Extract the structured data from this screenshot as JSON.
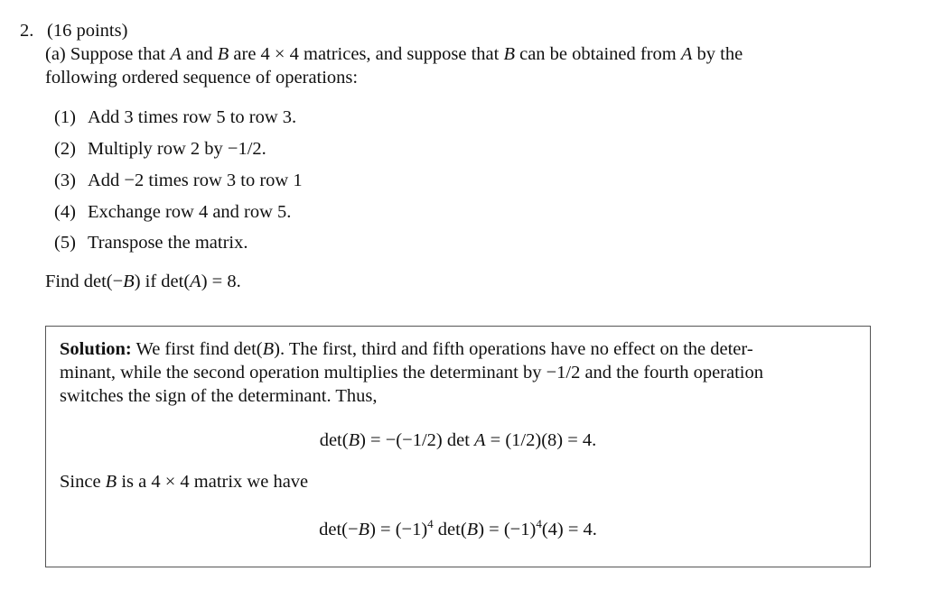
{
  "question": {
    "number": "2.",
    "points": "(16 points)",
    "part_label": "(a)",
    "intro_line1_pre": "Suppose that ",
    "var_A": "A",
    "intro_and": " and ",
    "var_B": "B",
    "intro_line1_mid": " are 4 × 4 matrices, and suppose that ",
    "intro_line1_mid2": " can be obtained from ",
    "intro_line1_end": " by the",
    "intro_line2": "following ordered sequence of operations:",
    "operations": [
      {
        "label": "(1)",
        "text": "Add 3 times row 5 to row 3."
      },
      {
        "label": "(2)",
        "text": "Multiply row 2 by −1/2."
      },
      {
        "label": "(3)",
        "text": "Add −2 times row 3 to row 1"
      },
      {
        "label": "(4)",
        "text": "Exchange row 4 and row 5."
      },
      {
        "label": "(5)",
        "text": "Transpose the matrix."
      }
    ],
    "find_pre": "Find det(−",
    "find_mid": ") if det(",
    "find_end": ") = 8."
  },
  "solution": {
    "heading": "Solution:",
    "line1_a": " We first find det(",
    "line1_b": "). The first, third and fifth operations have no effect on the deter-",
    "line2": "minant, while the second operation multiplies the determinant by −1/2 and the fourth operation",
    "line3": "switches the sign of the determinant. Thus,",
    "eq1_a": "det(",
    "eq1_b": ") = −(−1/2) det ",
    "eq1_c": " = (1/2)(8) = 4.",
    "since_a": "Since ",
    "since_b": " is a 4 × 4 matrix we have",
    "eq2_a": "det(−",
    "eq2_b": ") = (−1)",
    "eq2_exp": "4",
    "eq2_c": " det(",
    "eq2_d": ") = (−1)",
    "eq2_e": "(4) = 4."
  }
}
